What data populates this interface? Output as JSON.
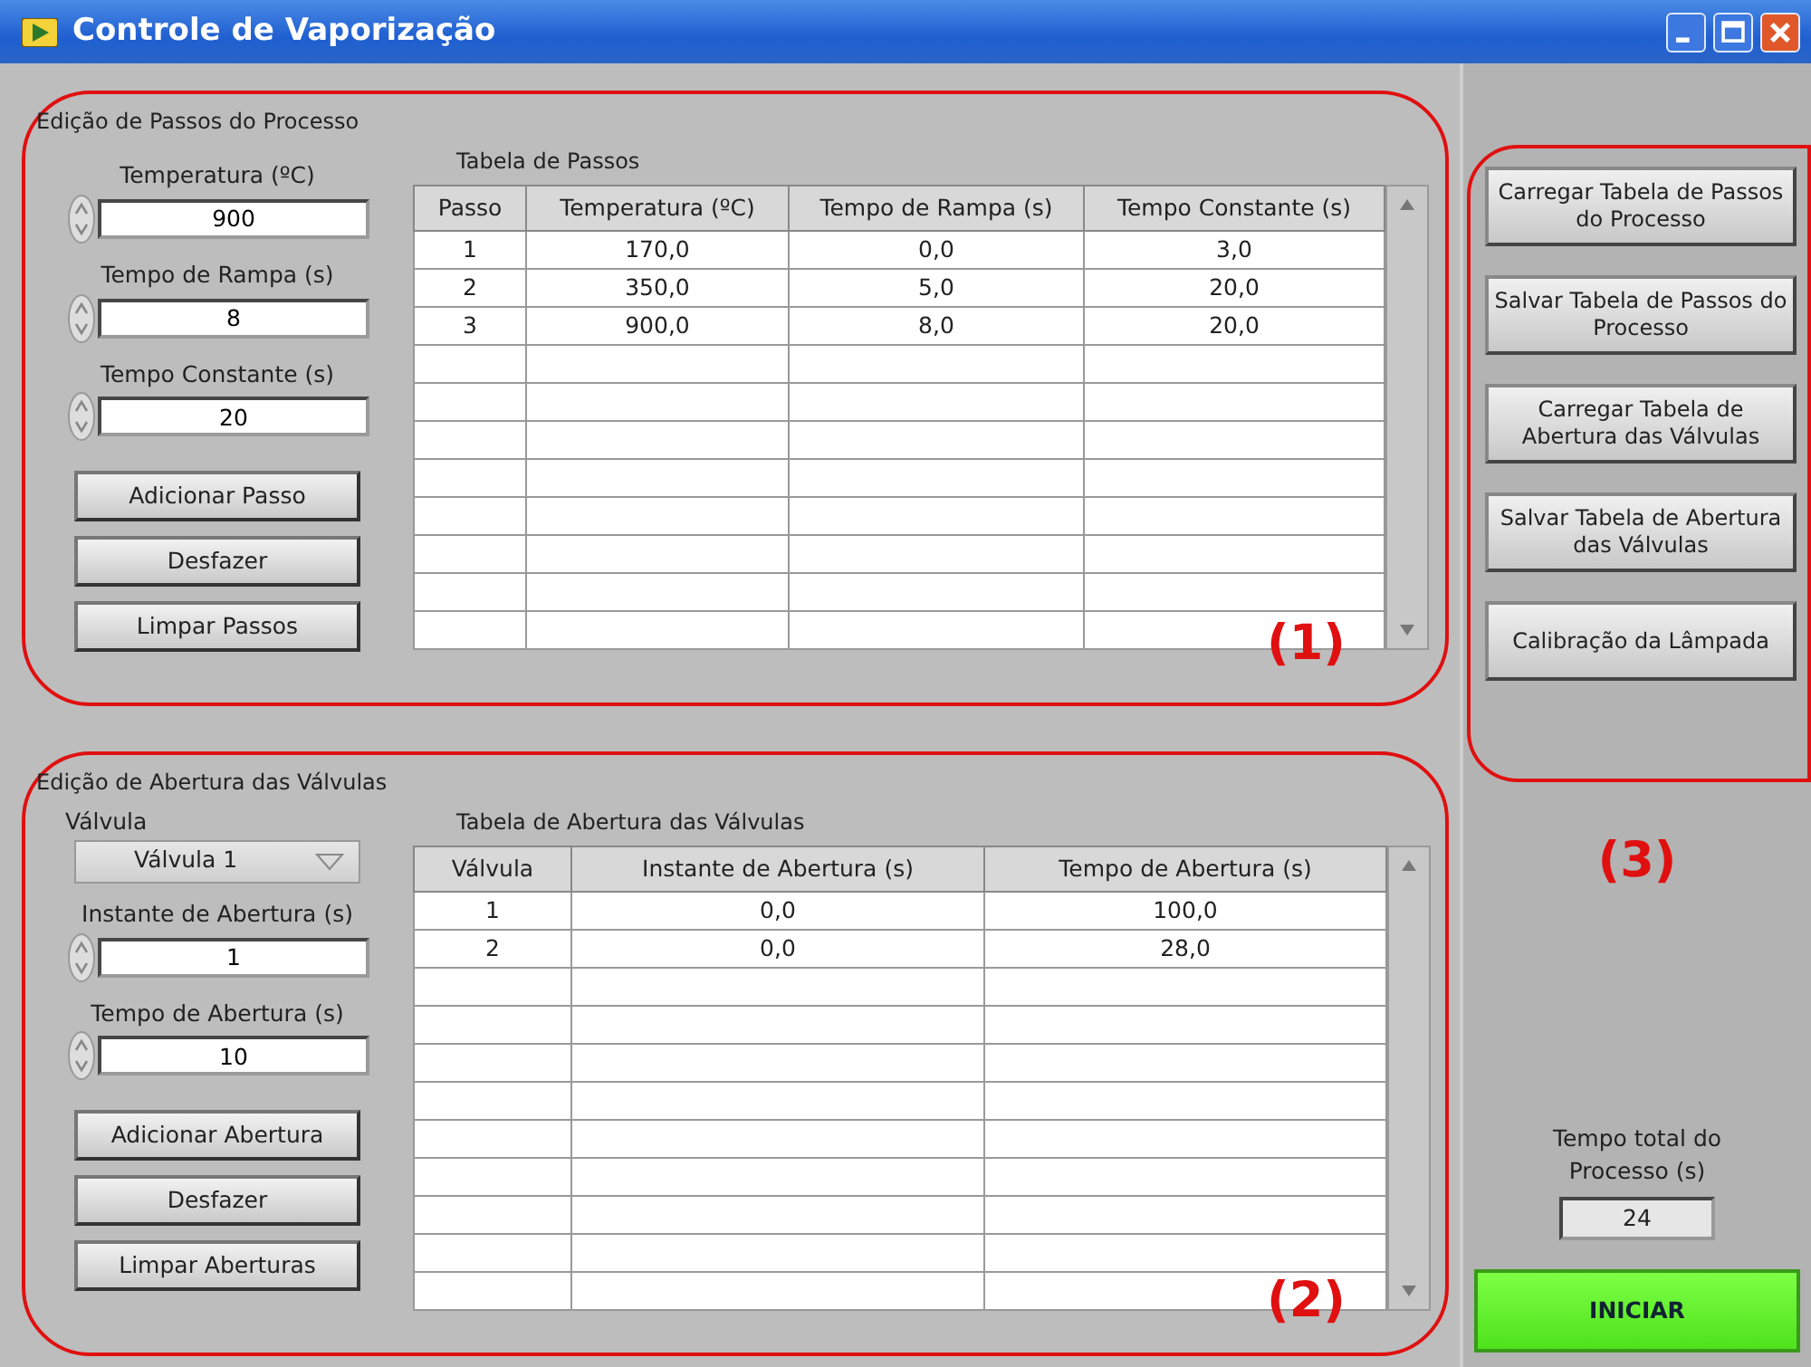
{
  "window": {
    "title": "Controle de Vaporização"
  },
  "steps_section": {
    "title": "Edição de Passos do Processo",
    "annotation": "(1)",
    "inputs": [
      {
        "label": "Temperatura (ºC)",
        "value": "900"
      },
      {
        "label": "Tempo de Rampa (s)",
        "value": "8"
      },
      {
        "label": "Tempo Constante (s)",
        "value": "20"
      }
    ],
    "buttons": [
      "Adicionar Passo",
      "Desfazer",
      "Limpar Passos"
    ],
    "table": {
      "title": "Tabela de Passos",
      "columns": [
        "Passo",
        "Temperatura (ºC)",
        "Tempo de Rampa (s)",
        "Tempo Constante (s)"
      ],
      "rows": [
        [
          "1",
          "170,0",
          "0,0",
          "3,0"
        ],
        [
          "2",
          "350,0",
          "5,0",
          "20,0"
        ],
        [
          "3",
          "900,0",
          "8,0",
          "20,0"
        ]
      ]
    }
  },
  "valves_section": {
    "title": "Edição de Abertura das Válvulas",
    "annotation": "(2)",
    "dropdown": {
      "label": "Válvula",
      "value": "Válvula 1"
    },
    "inputs": [
      {
        "label": "Instante de Abertura (s)",
        "value": "1"
      },
      {
        "label": "Tempo de Abertura (s)",
        "value": "10"
      }
    ],
    "buttons": [
      "Adicionar Abertura",
      "Desfazer",
      "Limpar Aberturas"
    ],
    "table": {
      "title": "Tabela de Abertura das Válvulas",
      "columns": [
        "Válvula",
        "Instante de Abertura (s)",
        "Tempo de Abertura (s)"
      ],
      "rows": [
        [
          "1",
          "0,0",
          "100,0"
        ],
        [
          "2",
          "0,0",
          "28,0"
        ]
      ]
    }
  },
  "actions": {
    "annotation": "(3)",
    "buttons": [
      "Carregar Tabela de Passos do Processo",
      "Salvar Tabela de Passos do Processo",
      "Carregar Tabela de Abertura das Válvulas",
      "Salvar Tabela de Abertura das Válvulas",
      "Calibração da Lâmpada"
    ]
  },
  "total_time": {
    "label": "Tempo total do Processo (s)",
    "value": "24"
  },
  "start_button": "INICIAR"
}
